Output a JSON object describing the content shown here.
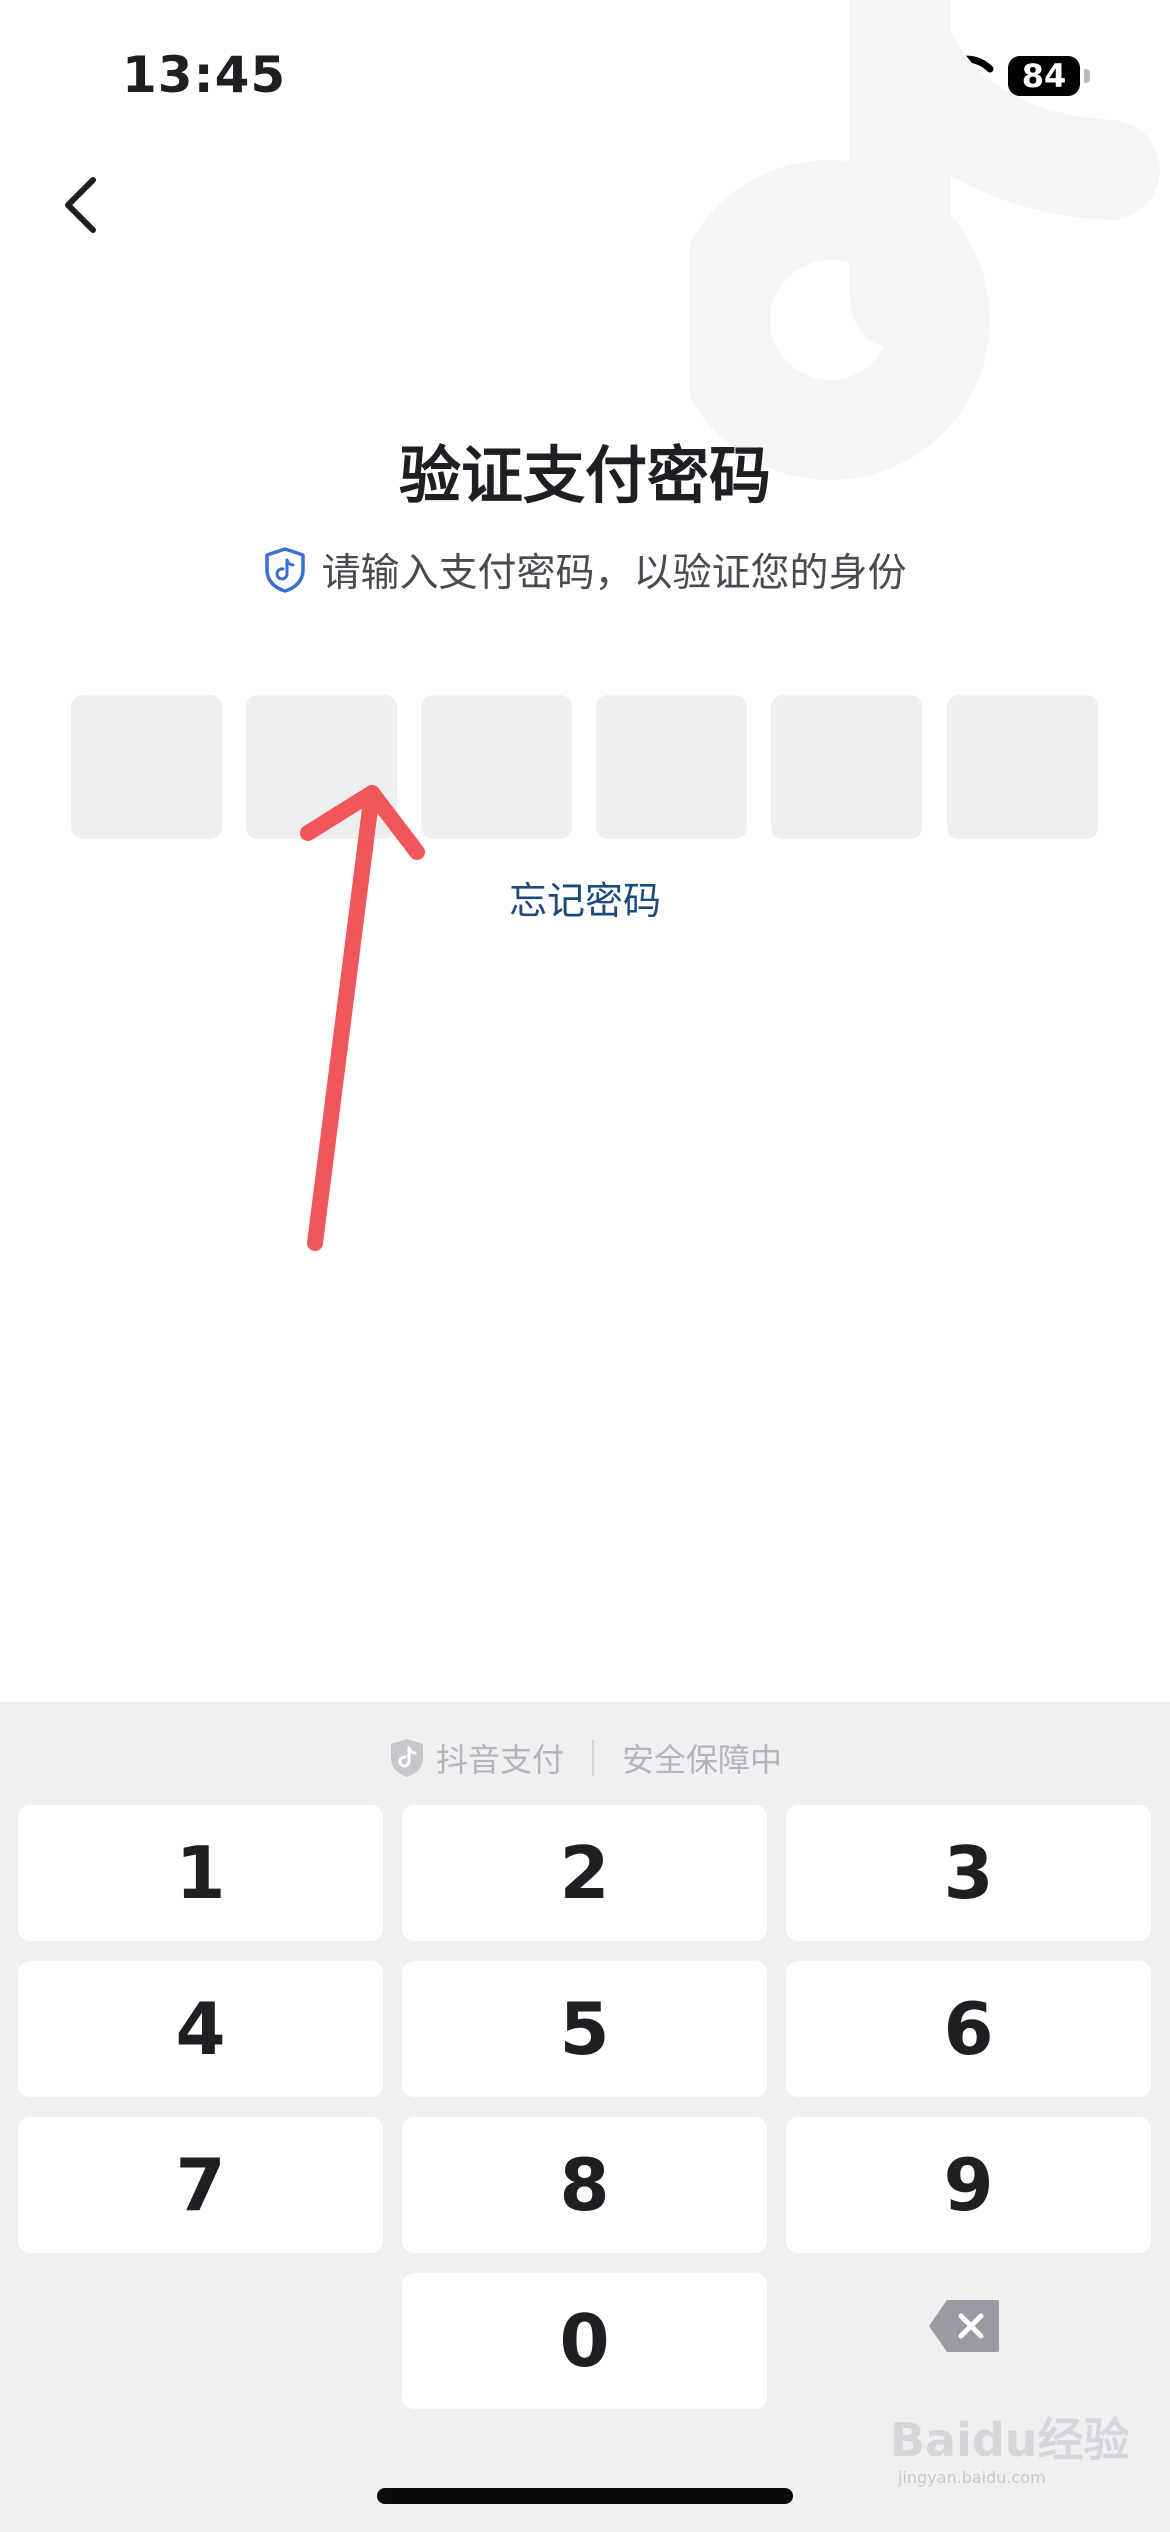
{
  "status_bar": {
    "time": "13:45",
    "battery": "84"
  },
  "header": {
    "title": "验证支付密码",
    "subtitle": "请输入支付密码，以验证您的身份"
  },
  "pin": {
    "length": 6,
    "filled": 0
  },
  "links": {
    "forgot_password": "忘记密码"
  },
  "keyboard": {
    "brand": "抖音支付",
    "security_text": "安全保障中",
    "keys": [
      "1",
      "2",
      "3",
      "4",
      "5",
      "6",
      "7",
      "8",
      "9",
      "0"
    ]
  },
  "watermark": {
    "brand": "Baidu经验",
    "domain": "jingyan.baidu.com"
  },
  "colors": {
    "annotation_arrow": "#f0565a",
    "link": "#1e4a7a",
    "shield": "#3a6fd8"
  },
  "icons": [
    "back-chevron-icon",
    "shield-icon",
    "douyin-logo-icon",
    "delete-key-icon"
  ]
}
